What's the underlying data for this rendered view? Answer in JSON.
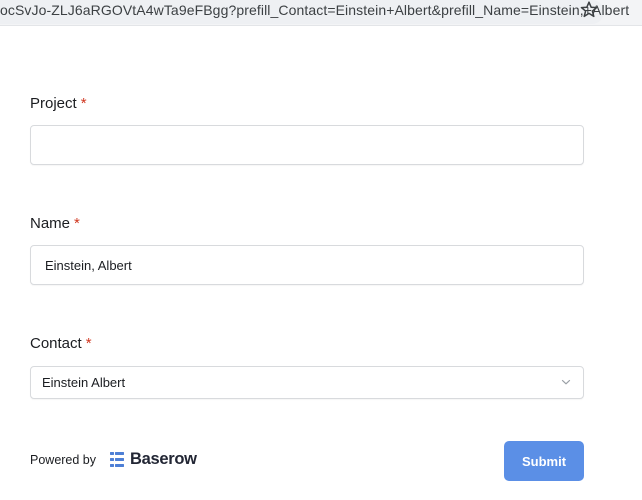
{
  "browser": {
    "url": "ocSvJo-ZLJ6aRGOVtA4wTa9eFBgg?prefill_Contact=Einstein+Albert&prefill_Name=Einstein,+Albert",
    "bookmark_icon": "star-icon"
  },
  "form": {
    "fields": [
      {
        "label": "Project",
        "required_marker": "*",
        "value": ""
      },
      {
        "label": "Name",
        "required_marker": "*",
        "value": "Einstein, Albert"
      },
      {
        "label": "Contact",
        "required_marker": "*",
        "selected": "Einstein Albert"
      }
    ],
    "submit_label": "Submit"
  },
  "footer": {
    "powered_by": "Powered by",
    "brand": "Baserow",
    "brand_icon": "baserow-logo-icon"
  },
  "colors": {
    "accent": "#5b8fe6",
    "required": "#d0361f",
    "brand_blue": "#4d7fd6"
  }
}
